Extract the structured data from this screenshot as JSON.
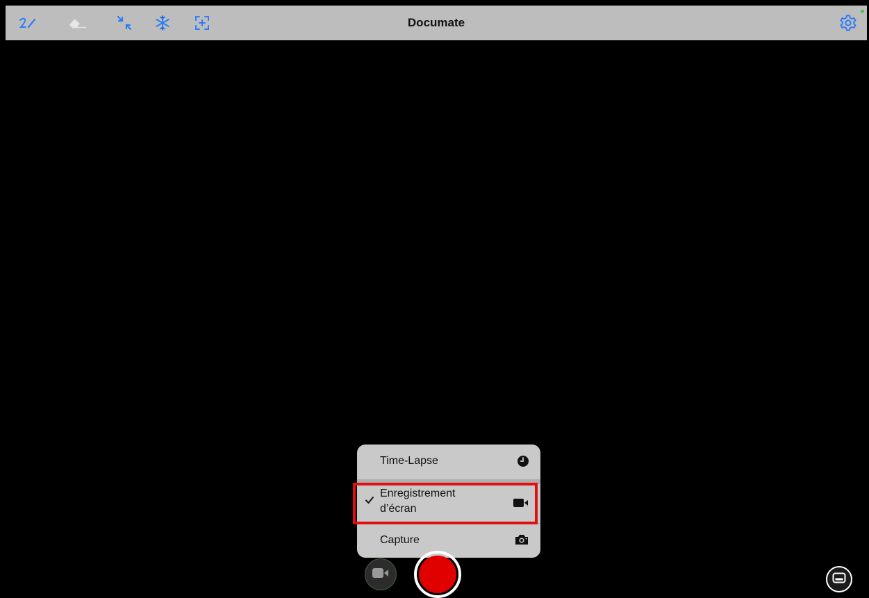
{
  "app": {
    "title": "Documate"
  },
  "toolbar": {
    "icons": [
      "pen-icon",
      "eraser-icon",
      "collapse-icon",
      "freeze-icon",
      "focus-icon"
    ],
    "settings_icon": "gear-icon",
    "accent": "#2f7cf6"
  },
  "capture_menu": {
    "items": [
      {
        "label": "Time-Lapse",
        "icon": "clock-icon",
        "selected": false
      },
      {
        "label": "Enregistrement",
        "label_line2": "d’écran",
        "icon": "video-camera-icon",
        "selected": true
      },
      {
        "label": "Capture",
        "icon": "camera-icon",
        "selected": false
      }
    ]
  },
  "controls": {
    "mode_icon": "video-camera-icon",
    "record_color": "#e00000",
    "caption_icon": "caption-icon"
  }
}
